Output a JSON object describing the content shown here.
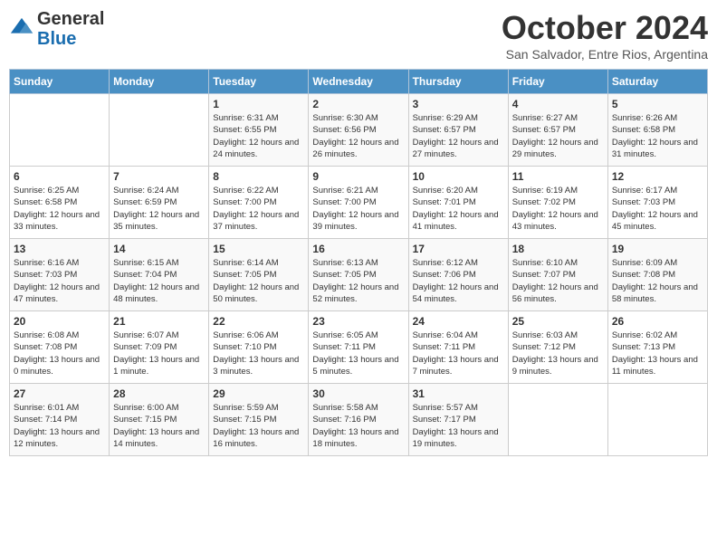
{
  "header": {
    "logo_line1": "General",
    "logo_line2": "Blue",
    "month_title": "October 2024",
    "location": "San Salvador, Entre Rios, Argentina"
  },
  "days_of_week": [
    "Sunday",
    "Monday",
    "Tuesday",
    "Wednesday",
    "Thursday",
    "Friday",
    "Saturday"
  ],
  "weeks": [
    [
      {
        "day": "",
        "info": ""
      },
      {
        "day": "",
        "info": ""
      },
      {
        "day": "1",
        "info": "Sunrise: 6:31 AM\nSunset: 6:55 PM\nDaylight: 12 hours and 24 minutes."
      },
      {
        "day": "2",
        "info": "Sunrise: 6:30 AM\nSunset: 6:56 PM\nDaylight: 12 hours and 26 minutes."
      },
      {
        "day": "3",
        "info": "Sunrise: 6:29 AM\nSunset: 6:57 PM\nDaylight: 12 hours and 27 minutes."
      },
      {
        "day": "4",
        "info": "Sunrise: 6:27 AM\nSunset: 6:57 PM\nDaylight: 12 hours and 29 minutes."
      },
      {
        "day": "5",
        "info": "Sunrise: 6:26 AM\nSunset: 6:58 PM\nDaylight: 12 hours and 31 minutes."
      }
    ],
    [
      {
        "day": "6",
        "info": "Sunrise: 6:25 AM\nSunset: 6:58 PM\nDaylight: 12 hours and 33 minutes."
      },
      {
        "day": "7",
        "info": "Sunrise: 6:24 AM\nSunset: 6:59 PM\nDaylight: 12 hours and 35 minutes."
      },
      {
        "day": "8",
        "info": "Sunrise: 6:22 AM\nSunset: 7:00 PM\nDaylight: 12 hours and 37 minutes."
      },
      {
        "day": "9",
        "info": "Sunrise: 6:21 AM\nSunset: 7:00 PM\nDaylight: 12 hours and 39 minutes."
      },
      {
        "day": "10",
        "info": "Sunrise: 6:20 AM\nSunset: 7:01 PM\nDaylight: 12 hours and 41 minutes."
      },
      {
        "day": "11",
        "info": "Sunrise: 6:19 AM\nSunset: 7:02 PM\nDaylight: 12 hours and 43 minutes."
      },
      {
        "day": "12",
        "info": "Sunrise: 6:17 AM\nSunset: 7:03 PM\nDaylight: 12 hours and 45 minutes."
      }
    ],
    [
      {
        "day": "13",
        "info": "Sunrise: 6:16 AM\nSunset: 7:03 PM\nDaylight: 12 hours and 47 minutes."
      },
      {
        "day": "14",
        "info": "Sunrise: 6:15 AM\nSunset: 7:04 PM\nDaylight: 12 hours and 48 minutes."
      },
      {
        "day": "15",
        "info": "Sunrise: 6:14 AM\nSunset: 7:05 PM\nDaylight: 12 hours and 50 minutes."
      },
      {
        "day": "16",
        "info": "Sunrise: 6:13 AM\nSunset: 7:05 PM\nDaylight: 12 hours and 52 minutes."
      },
      {
        "day": "17",
        "info": "Sunrise: 6:12 AM\nSunset: 7:06 PM\nDaylight: 12 hours and 54 minutes."
      },
      {
        "day": "18",
        "info": "Sunrise: 6:10 AM\nSunset: 7:07 PM\nDaylight: 12 hours and 56 minutes."
      },
      {
        "day": "19",
        "info": "Sunrise: 6:09 AM\nSunset: 7:08 PM\nDaylight: 12 hours and 58 minutes."
      }
    ],
    [
      {
        "day": "20",
        "info": "Sunrise: 6:08 AM\nSunset: 7:08 PM\nDaylight: 13 hours and 0 minutes."
      },
      {
        "day": "21",
        "info": "Sunrise: 6:07 AM\nSunset: 7:09 PM\nDaylight: 13 hours and 1 minute."
      },
      {
        "day": "22",
        "info": "Sunrise: 6:06 AM\nSunset: 7:10 PM\nDaylight: 13 hours and 3 minutes."
      },
      {
        "day": "23",
        "info": "Sunrise: 6:05 AM\nSunset: 7:11 PM\nDaylight: 13 hours and 5 minutes."
      },
      {
        "day": "24",
        "info": "Sunrise: 6:04 AM\nSunset: 7:11 PM\nDaylight: 13 hours and 7 minutes."
      },
      {
        "day": "25",
        "info": "Sunrise: 6:03 AM\nSunset: 7:12 PM\nDaylight: 13 hours and 9 minutes."
      },
      {
        "day": "26",
        "info": "Sunrise: 6:02 AM\nSunset: 7:13 PM\nDaylight: 13 hours and 11 minutes."
      }
    ],
    [
      {
        "day": "27",
        "info": "Sunrise: 6:01 AM\nSunset: 7:14 PM\nDaylight: 13 hours and 12 minutes."
      },
      {
        "day": "28",
        "info": "Sunrise: 6:00 AM\nSunset: 7:15 PM\nDaylight: 13 hours and 14 minutes."
      },
      {
        "day": "29",
        "info": "Sunrise: 5:59 AM\nSunset: 7:15 PM\nDaylight: 13 hours and 16 minutes."
      },
      {
        "day": "30",
        "info": "Sunrise: 5:58 AM\nSunset: 7:16 PM\nDaylight: 13 hours and 18 minutes."
      },
      {
        "day": "31",
        "info": "Sunrise: 5:57 AM\nSunset: 7:17 PM\nDaylight: 13 hours and 19 minutes."
      },
      {
        "day": "",
        "info": ""
      },
      {
        "day": "",
        "info": ""
      }
    ]
  ]
}
